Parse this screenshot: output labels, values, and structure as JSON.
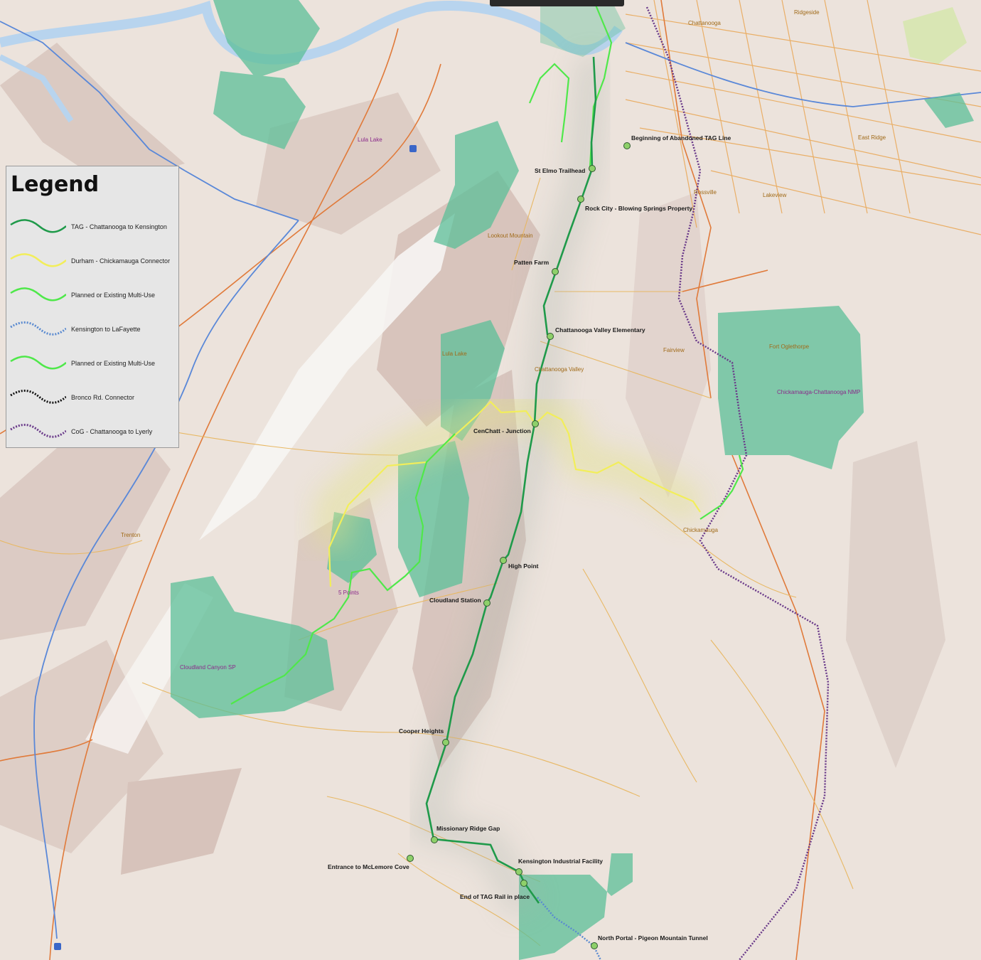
{
  "legend": {
    "title": "Legend",
    "items": [
      {
        "label": "TAG - Chattanooga to Kensington",
        "color": "#1f9a4a",
        "style": "solid"
      },
      {
        "label": "Durham - Chickamauga Connector",
        "color": "#f2ee5a",
        "style": "solid"
      },
      {
        "label": "Planned or Existing Multi-Use",
        "color": "#4fe84a",
        "style": "solid"
      },
      {
        "label": "Kensington to LaFayette",
        "color": "#5a8ad0",
        "style": "dotted"
      },
      {
        "label": "Planned or Existing Multi-Use",
        "color": "#4fe84a",
        "style": "solid"
      },
      {
        "label": "Bronco Rd. Connector",
        "color": "#111111",
        "style": "dotted"
      },
      {
        "label": "CoG - Chattanooga to Lyerly",
        "color": "#6a3a8a",
        "style": "dotted"
      }
    ]
  },
  "stops": [
    {
      "name": "Beginning of Abandoned TAG Line"
    },
    {
      "name": "St Elmo Trailhead"
    },
    {
      "name": "Rock City - Blowing Springs Property"
    },
    {
      "name": "Patten Farm"
    },
    {
      "name": "Chattanooga Valley Elementary"
    },
    {
      "name": "CenChatt - Junction"
    },
    {
      "name": "High Point"
    },
    {
      "name": "Cloudland Station"
    },
    {
      "name": "Cooper Heights"
    },
    {
      "name": "Missionary Ridge Gap"
    },
    {
      "name": "Entrance to McLemore Cove"
    },
    {
      "name": "Kensington Industrial Facility"
    },
    {
      "name": "End of TAG Rail in place"
    },
    {
      "name": "North Portal - Pigeon Mountain Tunnel"
    }
  ],
  "places": {
    "chattanooga": "Chattanooga",
    "ridgeside": "Ridgeside",
    "east_ridge": "East Ridge",
    "rossville": "Rossville",
    "lakeview": "Lakeview",
    "lula_lake_top": "Lula Lake",
    "lookout_mountain": "Lookout Mountain",
    "lula_lake": "Lula Lake",
    "chattanooga_valley": "Chattanooga Valley",
    "fairview": "Fairview",
    "fort_oglethorpe": "Fort Oglethorpe",
    "nmp": "Chickamauga-Chattanooga NMP",
    "chickamauga": "Chickamauga",
    "trenton": "Trenton",
    "five_points": "5 Points",
    "cloudland_canyon": "Cloudland Canyon SP"
  },
  "colors": {
    "tag": "#1f9a4a",
    "connector": "#f2ee5a",
    "multi_use": "#4fe84a",
    "lafayette": "#5a8ad0",
    "cog": "#6a3a8a",
    "parkland": "#5cbf98",
    "water": "#b8d4ee",
    "road_major": "#e07a3a",
    "road_minor": "#e8b864",
    "highway": "#5a88d8",
    "stop_fill": "#8ed06a"
  }
}
